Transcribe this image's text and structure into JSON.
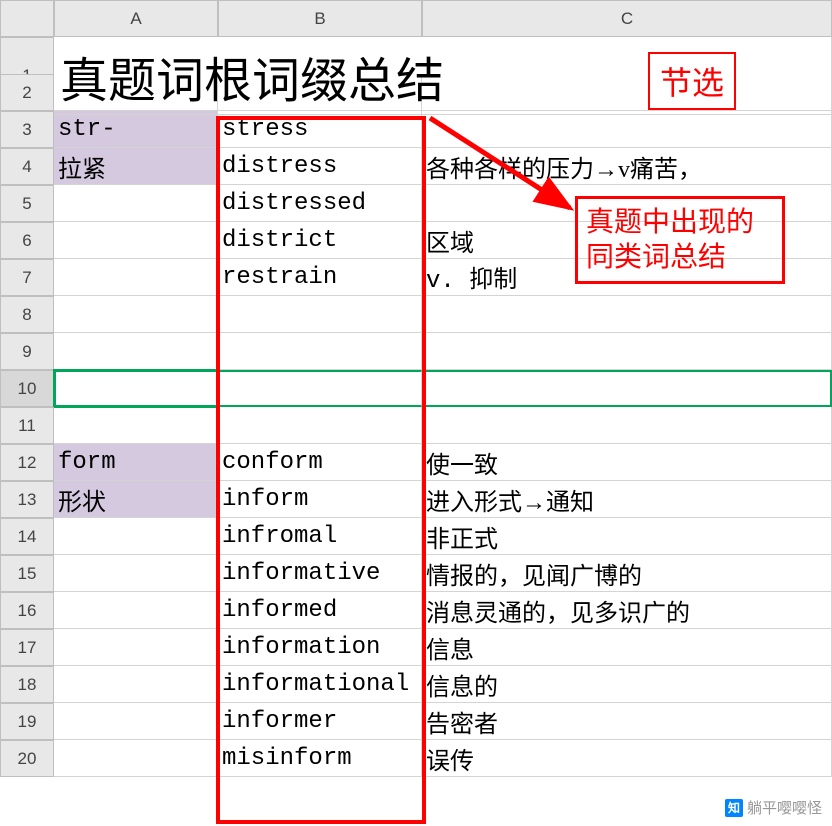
{
  "columns": {
    "corner": "",
    "A": "A",
    "B": "B",
    "C": "C"
  },
  "row_labels": [
    "1",
    "2",
    "3",
    "4",
    "5",
    "6",
    "7",
    "8",
    "9",
    "10",
    "11",
    "12",
    "13",
    "14",
    "15",
    "16",
    "17",
    "18",
    "19",
    "20"
  ],
  "title": "真题词根词缀总结",
  "excerpt_label": "节选",
  "rows": {
    "3": {
      "A": "str-",
      "B": "stress",
      "C": ""
    },
    "4": {
      "A": "拉紧",
      "B": "distress",
      "C": "各种各样的压力→v痛苦，"
    },
    "5": {
      "A": "",
      "B": "distressed",
      "C": ""
    },
    "6": {
      "A": "",
      "B": "district",
      "C": "区域"
    },
    "7": {
      "A": "",
      "B": "restrain",
      "C": "v. 抑制"
    },
    "8": {
      "A": "",
      "B": "",
      "C": ""
    },
    "9": {
      "A": "",
      "B": "",
      "C": ""
    },
    "10": {
      "A": "",
      "B": "",
      "C": ""
    },
    "11": {
      "A": "",
      "B": "",
      "C": ""
    },
    "12": {
      "A": "form",
      "B": "conform",
      "C": "使一致"
    },
    "13": {
      "A": "形状",
      "B": "inform",
      "C": "进入形式→通知"
    },
    "14": {
      "A": "",
      "B": "infromal",
      "C": "非正式"
    },
    "15": {
      "A": "",
      "B": "informative",
      "C": "情报的，见闻广博的"
    },
    "16": {
      "A": "",
      "B": "informed",
      "C": "消息灵通的，见多识广的"
    },
    "17": {
      "A": "",
      "B": "information",
      "C": "信息"
    },
    "18": {
      "A": "",
      "B": "informational",
      "C": "信息的"
    },
    "19": {
      "A": "",
      "B": "informer",
      "C": "告密者"
    },
    "20": {
      "A": "",
      "B": "misinform",
      "C": "误传"
    }
  },
  "callout": "真题中出现的同类词总结",
  "watermark": {
    "icon": "知",
    "text": "躺平嘤嘤怪"
  },
  "annotations": {
    "colB_box": "column-B-highlight",
    "arrow": "arrow-to-callout"
  }
}
